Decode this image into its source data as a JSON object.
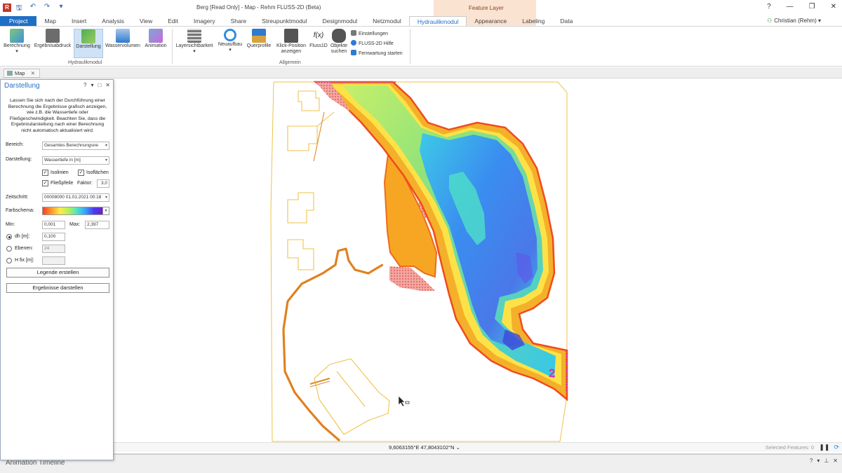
{
  "window": {
    "title": "Berg [Read Only] - Map - Rehm FLUSS-2D (Beta)",
    "feature_layer": "Feature Layer",
    "help": "?",
    "minimize": "—",
    "restore": "❐",
    "close": "✕",
    "app_icon": "R"
  },
  "qat": [
    "🖫",
    "↶",
    "↷",
    "▾"
  ],
  "tabs": [
    "Project",
    "Map",
    "Insert",
    "Analysis",
    "View",
    "Edit",
    "Imagery",
    "Share",
    "Streupunktmodul",
    "Designmodul",
    "Netzmodul",
    "Hydraulikmodul",
    "Appearance",
    "Labeling",
    "Data"
  ],
  "active_tab": "Hydraulikmodul",
  "user": "Christian (Rehm)",
  "ribbon": {
    "hydraulik": {
      "berechnung": "Berechnung",
      "ergebnisabdruck": "Ergebnisabdruck",
      "darstellung": "Darstellung",
      "wasservolumen": "Wasservolumen",
      "animation": "Animation",
      "group": "Hydraulikmodul"
    },
    "allgemein": {
      "layersichtbarkeit": "Layersichtbarkeit",
      "neuaufbau": "Neuaufbau",
      "querprofile": "Querprofile",
      "klick_line1": "Klick-Position",
      "klick_line2": "anzeigen",
      "fluss1d": "Fluss1D",
      "objekte_line1": "Objekte",
      "objekte_line2": "suchen",
      "einstellungen": "Einstellungen",
      "hilfe": "FLUSS-2D Hilfe",
      "fernwartung": "Fernwartung starten",
      "group": "Allgemein"
    }
  },
  "doc_tab": "Map",
  "pane": {
    "title": "Darstellung",
    "description": "Lassen Sie sich nach der Durchführung einer Berechnung die Ergebnisse grafisch anzeigen, wie z.B. die Wassertiefe oder Fließgeschwindigkeit. Beachten Sie, dass die Ergebnisdarstellung nach einer Berechnung nicht automatisch aktualisiert wird.",
    "bereich_label": "Bereich:",
    "bereich_value": "Gesamtes Berechnungsne",
    "darstellung_label": "Darstellung:",
    "darstellung_value": "Wassertiefe in [m]",
    "isolinien": "Isolinien",
    "isoflaechen": "Isoflächen",
    "fliesspfeile": "Fließpfeile",
    "faktor_label": "Faktor:",
    "faktor_value": "3,0",
    "zeitschritt_label": "Zeitschritt:",
    "zeitschritt_value": "00008000 01.01.2021 00:18",
    "farbschema_label": "Farbschema:",
    "min_label": "Min:",
    "min_value": "0,001",
    "max_label": "Max:",
    "max_value": "2,397",
    "dh_label": "dh [m]:",
    "dh_value": "0,100",
    "ebenen_label": "Ebenen:",
    "ebenen_value": "24",
    "hfix_label": "H fix [m]:",
    "hfix_value": "",
    "legende_button": "Legende erstellen",
    "ergebnisse_button": "Ergebnisse darstellen",
    "checked_mark": "✓"
  },
  "status": {
    "coords": "9,6063155°E 47,8043102°N",
    "selected": "Selected Features: 0"
  },
  "map": {
    "label": "2"
  },
  "bottom": {
    "title": "Animation Timeline"
  },
  "colors": {
    "accent": "#1f6fc5",
    "project_tab": "#1f6fc5",
    "feature_layer_band": "#fbe3d2"
  }
}
